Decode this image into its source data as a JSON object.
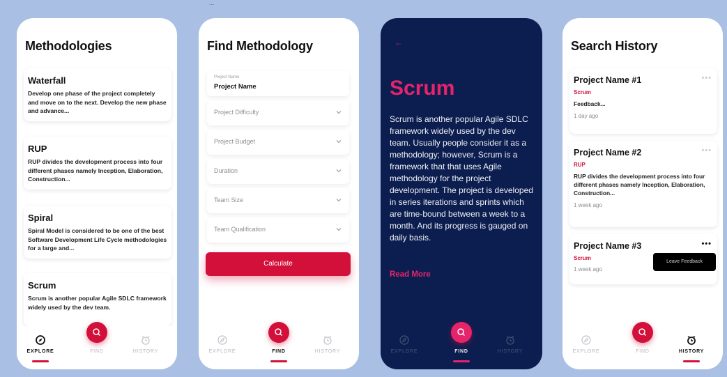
{
  "caption_fragment": "...",
  "colors": {
    "accent": "#d2103a",
    "navy": "#0c1e4f",
    "pink": "#e5246b",
    "background": "#a9bfe3"
  },
  "nav": {
    "explore": "EXPLORE",
    "find": "FIND",
    "history": "HISTORY"
  },
  "methodologies": {
    "title": "Methodologies",
    "items": [
      {
        "title": "Waterfall",
        "desc": "Develop one phase of the project completely and move on to the next. Develop the new phase and advance..."
      },
      {
        "title": "RUP",
        "desc": "RUP divides the development process into four different phases namely Inception, Elaboration, Construction..."
      },
      {
        "title": "Spiral",
        "desc": "Spiral Model is considered to be one of the best Software Development Life Cycle methodologies for a large and..."
      },
      {
        "title": "Scrum",
        "desc": "Scrum is another popular Agile SDLC framework widely used by the dev team."
      }
    ]
  },
  "find": {
    "title": "Find Methodology",
    "name_label": "Project Name",
    "name_value": "Project Name",
    "fields": [
      "Project Difficulty",
      "Project Budget",
      "Duration",
      "Team Size",
      "Team Qualification"
    ],
    "button": "Calculate"
  },
  "detail": {
    "back": "←",
    "title": "Scrum",
    "body": "Scrum is another popular Agile SDLC framework widely used by the dev team. Usually people consider it as a methodology; however, Scrum is a framework that that uses Agile methodology for the project development. The project is developed in series iterations and sprints which are time-bound between a week to a month. And its progress is gauged on daily basis.",
    "read_more": "Read More"
  },
  "history": {
    "title": "Search History",
    "items": [
      {
        "title": "Project Name #1",
        "method": "Scrum",
        "feedback": "Feedback...",
        "time": "1 day ago"
      },
      {
        "title": "Project Name #2",
        "method": "RUP",
        "feedback": "RUP divides the development process into four different phases namely Inception, Elaboration, Construction...",
        "time": "1 week ago"
      },
      {
        "title": "Project Name #3",
        "method": "Scrum",
        "feedback": "",
        "time": "1 week ago"
      }
    ],
    "dots": "•••",
    "tooltip": "Leave Feedback"
  }
}
